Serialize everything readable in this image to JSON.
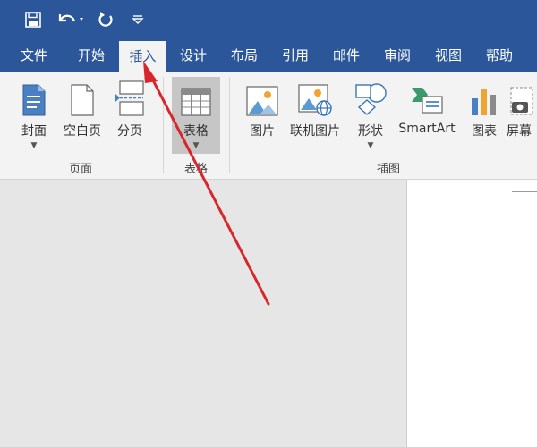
{
  "quick_access": {
    "save_icon": "save-icon",
    "undo_icon": "undo-icon",
    "redo_icon": "redo-icon",
    "customize_icon": "customize-dropdown-icon"
  },
  "tabs": [
    "文件",
    "开始",
    "插入",
    "设计",
    "布局",
    "引用",
    "邮件",
    "审阅",
    "视图",
    "帮助"
  ],
  "active_tab": "插入",
  "ribbon": {
    "pages_group": {
      "label": "页面",
      "buttons": [
        "封面",
        "空白页",
        "分页"
      ]
    },
    "tables_group": {
      "label": "表格",
      "buttons": [
        "表格"
      ]
    },
    "illustrations_group": {
      "label": "插图",
      "buttons": [
        "图片",
        "联机图片",
        "形状",
        "SmartArt",
        "图表",
        "屏幕"
      ]
    }
  },
  "colors": {
    "brand": "#2b579a",
    "ribbon_bg": "#f3f3f3",
    "arrow": "#d9262a"
  }
}
